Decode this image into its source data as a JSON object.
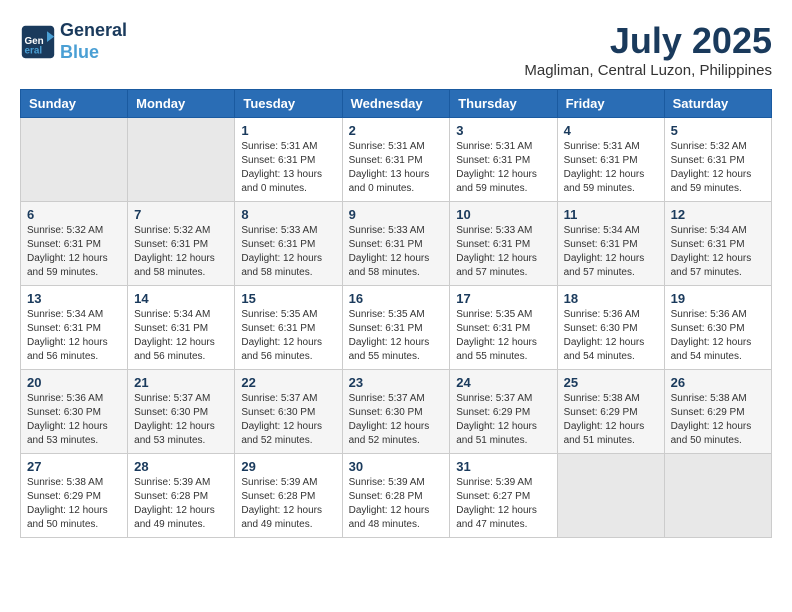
{
  "logo": {
    "line1": "General",
    "line2": "Blue"
  },
  "title": "July 2025",
  "subtitle": "Magliman, Central Luzon, Philippines",
  "weekdays": [
    "Sunday",
    "Monday",
    "Tuesday",
    "Wednesday",
    "Thursday",
    "Friday",
    "Saturday"
  ],
  "weeks": [
    [
      {
        "day": "",
        "info": ""
      },
      {
        "day": "",
        "info": ""
      },
      {
        "day": "1",
        "info": "Sunrise: 5:31 AM\nSunset: 6:31 PM\nDaylight: 13 hours and 0 minutes."
      },
      {
        "day": "2",
        "info": "Sunrise: 5:31 AM\nSunset: 6:31 PM\nDaylight: 13 hours and 0 minutes."
      },
      {
        "day": "3",
        "info": "Sunrise: 5:31 AM\nSunset: 6:31 PM\nDaylight: 12 hours and 59 minutes."
      },
      {
        "day": "4",
        "info": "Sunrise: 5:31 AM\nSunset: 6:31 PM\nDaylight: 12 hours and 59 minutes."
      },
      {
        "day": "5",
        "info": "Sunrise: 5:32 AM\nSunset: 6:31 PM\nDaylight: 12 hours and 59 minutes."
      }
    ],
    [
      {
        "day": "6",
        "info": "Sunrise: 5:32 AM\nSunset: 6:31 PM\nDaylight: 12 hours and 59 minutes."
      },
      {
        "day": "7",
        "info": "Sunrise: 5:32 AM\nSunset: 6:31 PM\nDaylight: 12 hours and 58 minutes."
      },
      {
        "day": "8",
        "info": "Sunrise: 5:33 AM\nSunset: 6:31 PM\nDaylight: 12 hours and 58 minutes."
      },
      {
        "day": "9",
        "info": "Sunrise: 5:33 AM\nSunset: 6:31 PM\nDaylight: 12 hours and 58 minutes."
      },
      {
        "day": "10",
        "info": "Sunrise: 5:33 AM\nSunset: 6:31 PM\nDaylight: 12 hours and 57 minutes."
      },
      {
        "day": "11",
        "info": "Sunrise: 5:34 AM\nSunset: 6:31 PM\nDaylight: 12 hours and 57 minutes."
      },
      {
        "day": "12",
        "info": "Sunrise: 5:34 AM\nSunset: 6:31 PM\nDaylight: 12 hours and 57 minutes."
      }
    ],
    [
      {
        "day": "13",
        "info": "Sunrise: 5:34 AM\nSunset: 6:31 PM\nDaylight: 12 hours and 56 minutes."
      },
      {
        "day": "14",
        "info": "Sunrise: 5:34 AM\nSunset: 6:31 PM\nDaylight: 12 hours and 56 minutes."
      },
      {
        "day": "15",
        "info": "Sunrise: 5:35 AM\nSunset: 6:31 PM\nDaylight: 12 hours and 56 minutes."
      },
      {
        "day": "16",
        "info": "Sunrise: 5:35 AM\nSunset: 6:31 PM\nDaylight: 12 hours and 55 minutes."
      },
      {
        "day": "17",
        "info": "Sunrise: 5:35 AM\nSunset: 6:31 PM\nDaylight: 12 hours and 55 minutes."
      },
      {
        "day": "18",
        "info": "Sunrise: 5:36 AM\nSunset: 6:30 PM\nDaylight: 12 hours and 54 minutes."
      },
      {
        "day": "19",
        "info": "Sunrise: 5:36 AM\nSunset: 6:30 PM\nDaylight: 12 hours and 54 minutes."
      }
    ],
    [
      {
        "day": "20",
        "info": "Sunrise: 5:36 AM\nSunset: 6:30 PM\nDaylight: 12 hours and 53 minutes."
      },
      {
        "day": "21",
        "info": "Sunrise: 5:37 AM\nSunset: 6:30 PM\nDaylight: 12 hours and 53 minutes."
      },
      {
        "day": "22",
        "info": "Sunrise: 5:37 AM\nSunset: 6:30 PM\nDaylight: 12 hours and 52 minutes."
      },
      {
        "day": "23",
        "info": "Sunrise: 5:37 AM\nSunset: 6:30 PM\nDaylight: 12 hours and 52 minutes."
      },
      {
        "day": "24",
        "info": "Sunrise: 5:37 AM\nSunset: 6:29 PM\nDaylight: 12 hours and 51 minutes."
      },
      {
        "day": "25",
        "info": "Sunrise: 5:38 AM\nSunset: 6:29 PM\nDaylight: 12 hours and 51 minutes."
      },
      {
        "day": "26",
        "info": "Sunrise: 5:38 AM\nSunset: 6:29 PM\nDaylight: 12 hours and 50 minutes."
      }
    ],
    [
      {
        "day": "27",
        "info": "Sunrise: 5:38 AM\nSunset: 6:29 PM\nDaylight: 12 hours and 50 minutes."
      },
      {
        "day": "28",
        "info": "Sunrise: 5:39 AM\nSunset: 6:28 PM\nDaylight: 12 hours and 49 minutes."
      },
      {
        "day": "29",
        "info": "Sunrise: 5:39 AM\nSunset: 6:28 PM\nDaylight: 12 hours and 49 minutes."
      },
      {
        "day": "30",
        "info": "Sunrise: 5:39 AM\nSunset: 6:28 PM\nDaylight: 12 hours and 48 minutes."
      },
      {
        "day": "31",
        "info": "Sunrise: 5:39 AM\nSunset: 6:27 PM\nDaylight: 12 hours and 47 minutes."
      },
      {
        "day": "",
        "info": ""
      },
      {
        "day": "",
        "info": ""
      }
    ]
  ]
}
